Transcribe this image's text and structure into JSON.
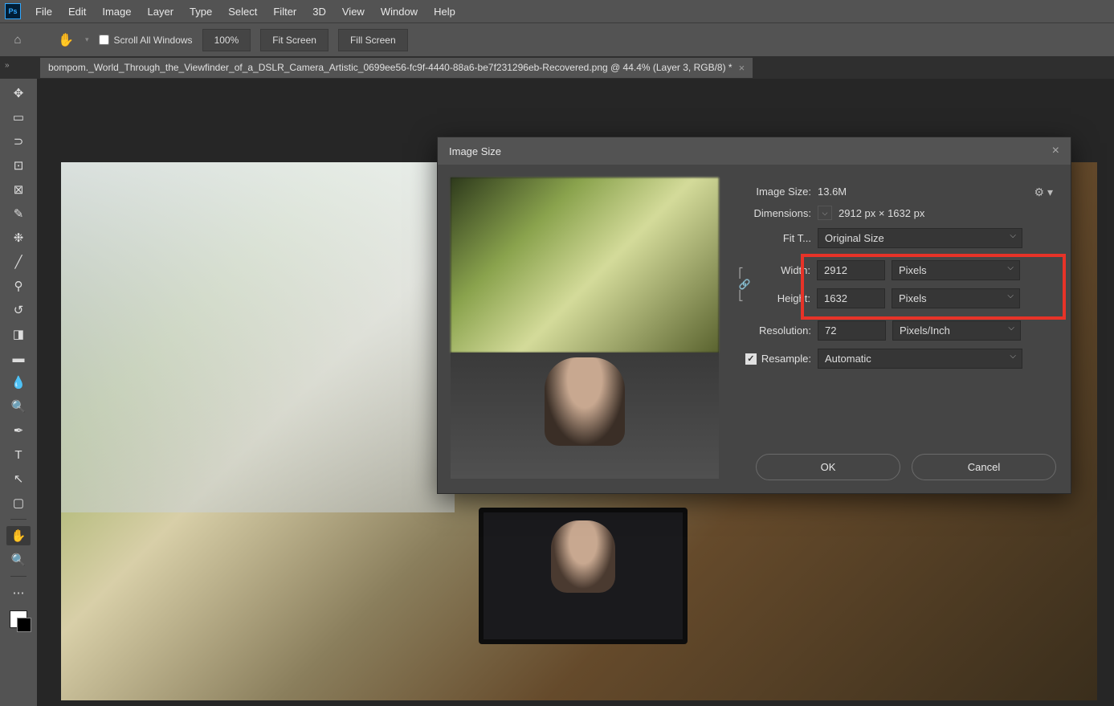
{
  "menubar": [
    "File",
    "Edit",
    "Image",
    "Layer",
    "Type",
    "Select",
    "Filter",
    "3D",
    "View",
    "Window",
    "Help"
  ],
  "optbar": {
    "scroll_all": "Scroll All Windows",
    "zoom": "100%",
    "fit": "Fit Screen",
    "fill": "Fill Screen"
  },
  "tab": {
    "title": "bompom._World_Through_the_Viewfinder_of_a_DSLR_Camera_Artistic_0699ee56-fc9f-4440-88a6-be7f231296eb-Recovered.png @ 44.4% (Layer 3, RGB/8) *"
  },
  "dialog": {
    "title": "Image Size",
    "image_size_label": "Image Size:",
    "image_size_val": "13.6M",
    "dimensions_label": "Dimensions:",
    "dimensions_val": "2912 px  ×  1632 px",
    "fit_to_label": "Fit T...",
    "fit_to_val": "Original Size",
    "width_label": "Width:",
    "width_val": "2912",
    "width_unit": "Pixels",
    "height_label": "Height:",
    "height_val": "1632",
    "height_unit": "Pixels",
    "res_label": "Resolution:",
    "res_val": "72",
    "res_unit": "Pixels/Inch",
    "resample_label": "Resample:",
    "resample_val": "Automatic",
    "ok": "OK",
    "cancel": "Cancel"
  },
  "tools": [
    "move",
    "marquee",
    "lasso",
    "crop",
    "frame",
    "eyedrop",
    "heal",
    "brush",
    "stamp",
    "history",
    "eraser",
    "gradient",
    "blur",
    "dodge",
    "pen",
    "type",
    "path",
    "rect",
    "hand",
    "zoom"
  ]
}
